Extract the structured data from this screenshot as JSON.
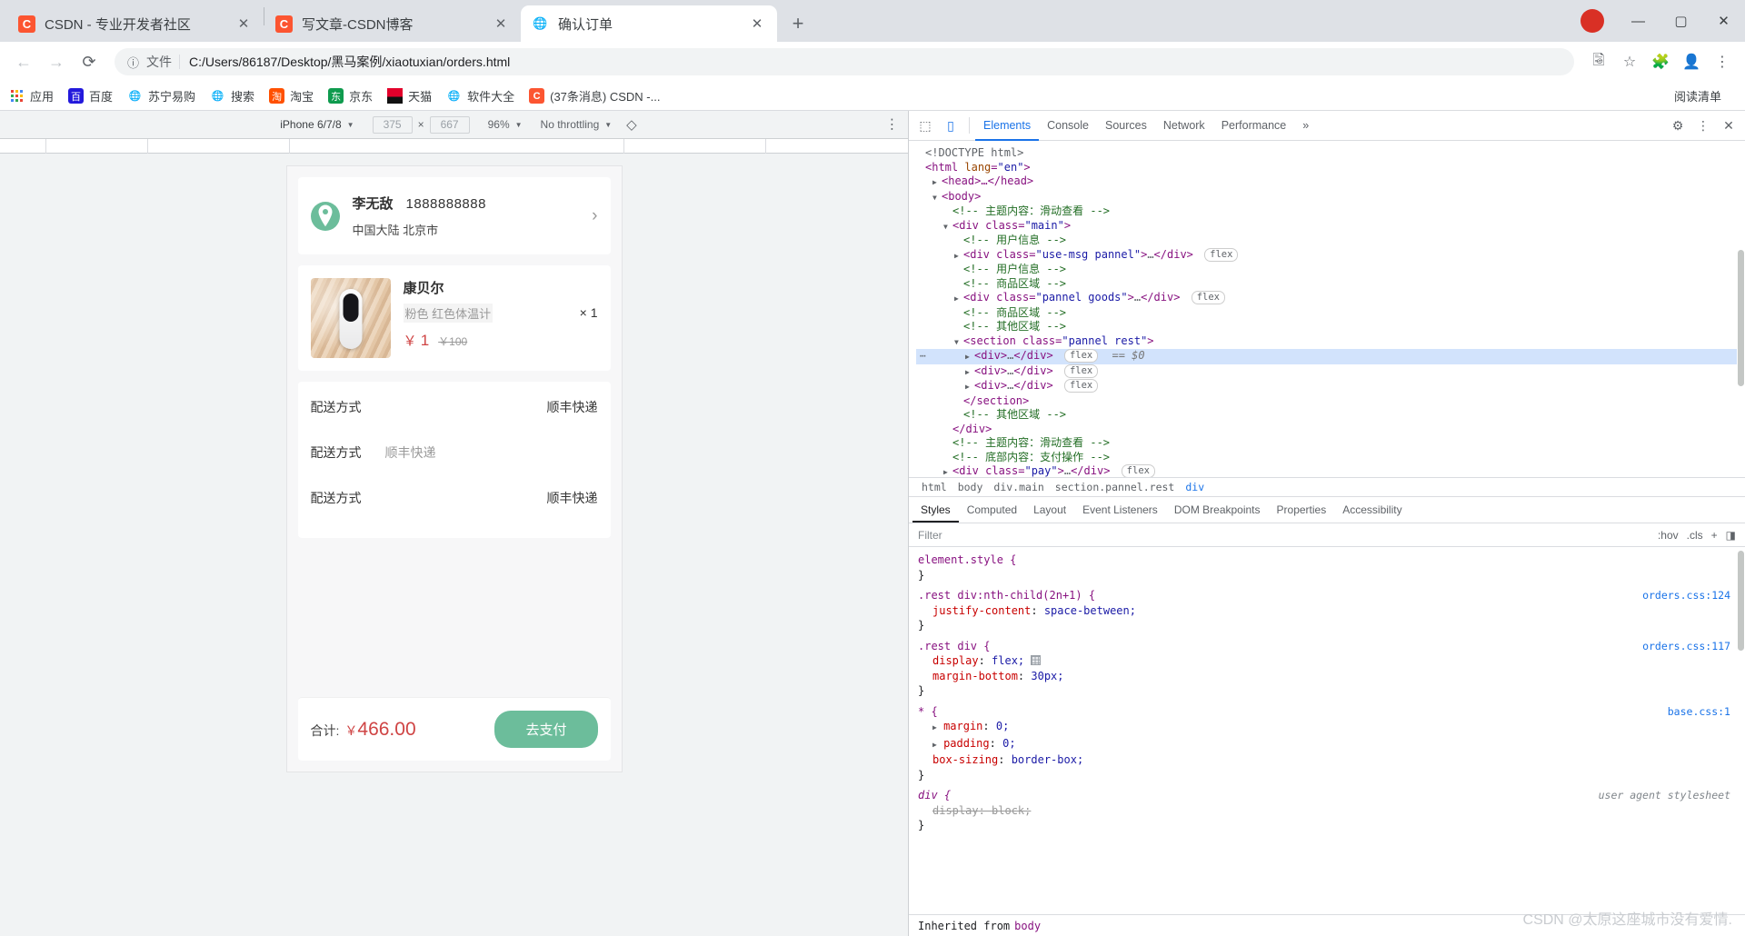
{
  "browser": {
    "tabs": [
      {
        "title": "CSDN - 专业开发者社区",
        "icon": "csdn-icon",
        "active": false,
        "close": "✕"
      },
      {
        "title": "写文章-CSDN博客",
        "icon": "csdn-icon",
        "active": false,
        "close": "✕"
      },
      {
        "title": "确认订单",
        "icon": "globe-icon",
        "active": true,
        "close": "✕"
      }
    ],
    "new_tab_label": "+",
    "window_controls": {
      "minimize": "—",
      "maximize": "▢",
      "close": "✕"
    },
    "profile_badge": "●",
    "nav": {
      "back": "←",
      "forward": "→",
      "reload": "⟳",
      "info": "ⓘ"
    },
    "omnibox": {
      "scheme_label": "文件",
      "url": "C:/Users/86187/Desktop/黑马案例/xiaotuxian/orders.html"
    },
    "toolbar_icons": [
      "translate-icon",
      "star-icon",
      "extensions-icon",
      "profile-icon",
      "menu-icon"
    ],
    "bookmarks": [
      {
        "label": "应用",
        "icon": "apps-grid-icon"
      },
      {
        "label": "百度",
        "icon": "baidu-icon"
      },
      {
        "label": "苏宁易购",
        "icon": "globe-icon"
      },
      {
        "label": "搜索",
        "icon": "globe-icon"
      },
      {
        "label": "淘宝",
        "icon": "taobao-icon"
      },
      {
        "label": "京东",
        "icon": "jd-icon"
      },
      {
        "label": "天猫",
        "icon": "tmall-icon"
      },
      {
        "label": "软件大全",
        "icon": "globe-icon"
      },
      {
        "label": "(37条消息) CSDN -...",
        "icon": "csdn-icon"
      }
    ],
    "reading_list": "阅读清单"
  },
  "device_toolbar": {
    "device": "iPhone 6/7/8",
    "width": "375",
    "height": "667",
    "multiply": "×",
    "zoom": "96%",
    "throttling": "No throttling",
    "rotate_icon": "rotate-icon",
    "more_icon": "kebab-icon",
    "caret": "▼"
  },
  "page": {
    "address": {
      "name": "李无敌",
      "phone": "1888888888",
      "detail": "中国大陆 北京市",
      "pin_icon": "location-pin-icon",
      "chevron": "›"
    },
    "goods": {
      "name": "康贝尔",
      "spec": "粉色  红色体温计",
      "price_symbol": "￥",
      "price": "1",
      "old_price": "￥100",
      "qty": "× 1",
      "image_alt": "thermometer-product-image"
    },
    "rest_rows": [
      {
        "label": "配送方式",
        "value": "顺丰快递",
        "muted": false,
        "layout": "between"
      },
      {
        "label": "配送方式",
        "value": "顺丰快递",
        "muted": true,
        "layout": "start"
      },
      {
        "label": "配送方式",
        "value": "顺丰快递",
        "muted": false,
        "layout": "between"
      }
    ],
    "paybar": {
      "total_label": "合计:",
      "total_symbol": "￥",
      "total_value": "466.00",
      "pay_button": "去支付"
    },
    "accent_color": "#6cbd9b",
    "price_color": "#cf4444"
  },
  "devtools": {
    "left_icons": [
      "inspect-icon",
      "device-toolbar-icon"
    ],
    "tabs": [
      "Elements",
      "Console",
      "Sources",
      "Network",
      "Performance"
    ],
    "active_tab": "Elements",
    "overflow": "»",
    "right_icons": [
      "settings-gear-icon",
      "kebab-icon",
      "close-icon"
    ],
    "dom_lines": [
      {
        "indent": 0,
        "tri": "",
        "html": "doctype"
      },
      {
        "indent": 0,
        "tri": "",
        "html": "html-open"
      },
      {
        "indent": 1,
        "tri": "▶",
        "html": "head"
      },
      {
        "indent": 1,
        "tri": "▼",
        "html": "body-open"
      },
      {
        "indent": 2,
        "tri": "",
        "html": "comment-main"
      },
      {
        "indent": 2,
        "tri": "▼",
        "html": "div-main"
      },
      {
        "indent": 3,
        "tri": "",
        "html": "comment-user1"
      },
      {
        "indent": 3,
        "tri": "▶",
        "html": "div-usemsg"
      },
      {
        "indent": 3,
        "tri": "",
        "html": "comment-user2"
      },
      {
        "indent": 3,
        "tri": "",
        "html": "comment-goods1"
      },
      {
        "indent": 3,
        "tri": "▶",
        "html": "div-goods"
      },
      {
        "indent": 3,
        "tri": "",
        "html": "comment-goods2"
      },
      {
        "indent": 3,
        "tri": "",
        "html": "comment-rest1"
      },
      {
        "indent": 3,
        "tri": "▼",
        "html": "section-rest"
      },
      {
        "indent": 4,
        "tri": "▶",
        "html": "div-flex-selected"
      },
      {
        "indent": 4,
        "tri": "▶",
        "html": "div-flex-2"
      },
      {
        "indent": 4,
        "tri": "▶",
        "html": "div-flex-3"
      },
      {
        "indent": 3,
        "tri": "",
        "html": "section-close"
      },
      {
        "indent": 3,
        "tri": "",
        "html": "comment-rest2"
      },
      {
        "indent": 2,
        "tri": "",
        "html": "div-close"
      },
      {
        "indent": 2,
        "tri": "",
        "html": "comment-main2"
      },
      {
        "indent": 2,
        "tri": "",
        "html": "comment-pay"
      },
      {
        "indent": 2,
        "tri": "▶",
        "html": "div-pay"
      }
    ],
    "dom_text": {
      "doctype": "<!DOCTYPE html>",
      "html_tag": "html",
      "html_attr": "lang",
      "html_val": "\"en\"",
      "head": "<head>…</head>",
      "body": "<body>",
      "comment_main": "<!-- 主题内容：滑动查看 -->",
      "div_main": "<div class=\"main\">",
      "comment_user": "<!-- 用户信息 -->",
      "div_usemsg": "<div class=\"use-msg pannel\">…</div>",
      "comment_goods": "<!-- 商品区域 -->",
      "div_goods": "<div class=\"pannel goods\">…</div>",
      "comment_rest": "<!-- 其他区域 -->",
      "section_rest": "<section class=\"pannel rest\">",
      "div_flex": "<div>…</div>",
      "section_close": "</section>",
      "div_close": "</div>",
      "comment_pay": "<!-- 底部内容：支付操作 -->",
      "div_pay": "<div class=\"pay\">…</div>",
      "flex_badge": "flex",
      "eq_dollar": "== $0",
      "ellipsis": "⋯"
    },
    "breadcrumb": [
      "html",
      "body",
      "div.main",
      "section.pannel.rest",
      "div"
    ],
    "breadcrumb_active": "div",
    "styles_tabs": [
      "Styles",
      "Computed",
      "Layout",
      "Event Listeners",
      "DOM Breakpoints",
      "Properties",
      "Accessibility"
    ],
    "styles_active": "Styles",
    "filter": {
      "placeholder": "Filter",
      "hov": ":hov",
      "cls": ".cls",
      "plus": "+",
      "panel": "◨"
    },
    "rules": [
      {
        "selector": "element.style {",
        "source": "",
        "decls": [],
        "close": "}"
      },
      {
        "selector": ".rest div:nth-child(2n+1) {",
        "source": "orders.css:124",
        "decls": [
          {
            "prop": "justify-content",
            "value": "space-between;",
            "strike": false,
            "tri": "",
            "grid": false
          }
        ],
        "close": "}"
      },
      {
        "selector": ".rest div {",
        "source": "orders.css:117",
        "decls": [
          {
            "prop": "display",
            "value": "flex;",
            "strike": false,
            "tri": "",
            "grid": true
          },
          {
            "prop": "margin-bottom",
            "value": "30px;",
            "strike": false,
            "tri": "",
            "grid": false
          }
        ],
        "close": "}"
      },
      {
        "selector": "* {",
        "source": "base.css:1",
        "decls": [
          {
            "prop": "margin",
            "value": "0;",
            "strike": false,
            "tri": "▶",
            "grid": false
          },
          {
            "prop": "padding",
            "value": "0;",
            "strike": false,
            "tri": "▶",
            "grid": false
          },
          {
            "prop": "box-sizing",
            "value": "border-box;",
            "strike": false,
            "tri": "",
            "grid": false
          }
        ],
        "close": "}"
      },
      {
        "selector": "div {",
        "source": "user agent stylesheet",
        "source_ua": true,
        "decls": [
          {
            "prop": "display",
            "value": "block;",
            "strike": true,
            "tri": "",
            "grid": false
          }
        ],
        "close": "}"
      }
    ],
    "inherited_label": "Inherited from",
    "inherited_from": "body"
  },
  "watermark": "CSDN @太原这座城市没有爱情."
}
